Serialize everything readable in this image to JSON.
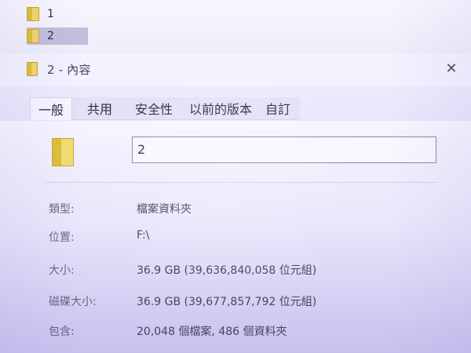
{
  "explorer": {
    "items": [
      {
        "label": "1"
      },
      {
        "label": "2"
      }
    ]
  },
  "dialog": {
    "title": "2 - 內容",
    "tabs": [
      {
        "label": "一般"
      },
      {
        "label": "共用"
      },
      {
        "label": "安全性"
      },
      {
        "label": "以前的版本"
      },
      {
        "label": "自訂"
      }
    ],
    "name_value": "2",
    "fields": {
      "type_label": "類型:",
      "type_value": "檔案資料夾",
      "location_label": "位置:",
      "location_value": "F:\\",
      "size_label": "大小:",
      "size_value": "36.9 GB (39,636,840,058 位元組)",
      "disk_size_label": "磁碟大小:",
      "disk_size_value": "36.9 GB (39,677,857,792 位元組)",
      "contains_label": "包含:",
      "contains_value": "20,048 個檔案, 486 個資料夾"
    }
  },
  "icons": {
    "folder": "folder-icon",
    "close": "close-icon"
  },
  "colors": {
    "accent_bg": "#c9c2ec",
    "folder_yellow": "#dcbf37"
  }
}
